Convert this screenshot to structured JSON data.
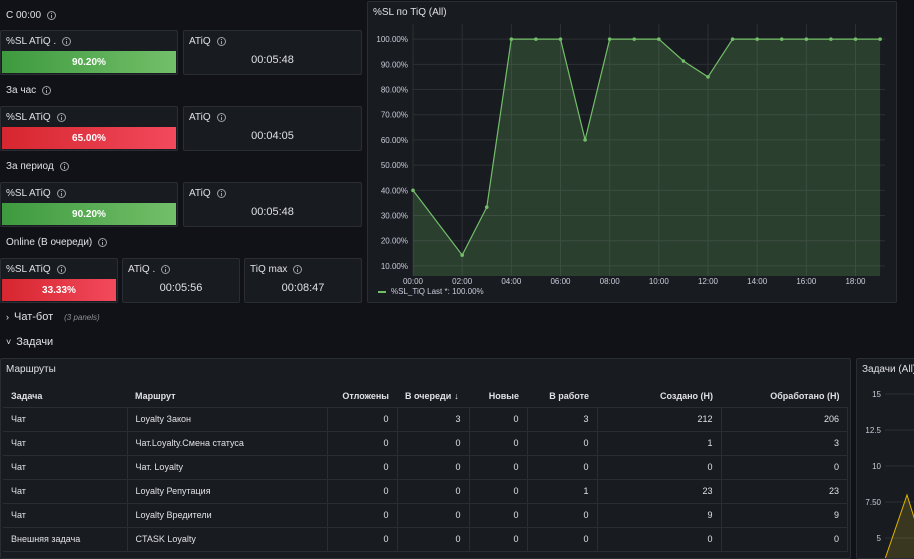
{
  "rows": {
    "c0000": "С 00:00",
    "hour": "За час",
    "period": "За период",
    "online": "Online (В очереди)"
  },
  "stats": {
    "c0000": {
      "sl_title": "%SL ATiQ .",
      "sl_value": "90.20%",
      "atiq_title": "ATiQ",
      "atiq_value": "00:05:48"
    },
    "hour": {
      "sl_title": "%SL ATiQ",
      "sl_value": "65.00%",
      "atiq_title": "ATiQ",
      "atiq_value": "00:04:05"
    },
    "period": {
      "sl_title": "%SL ATiQ",
      "sl_value": "90.20%",
      "atiq_title": "ATiQ",
      "atiq_value": "00:05:48"
    },
    "online": {
      "sl_title": "%SL ATiQ",
      "sl_value": "33.33%",
      "atiq_title": "ATiQ .",
      "atiq_value": "00:05:56",
      "tiq_title": "TiQ max",
      "tiq_value": "00:08:47"
    }
  },
  "colors": {
    "green": "#73bf69",
    "red": "#f2495c",
    "bg": "#111217",
    "panel": "#181b1f"
  },
  "chart": {
    "title": "%SL по TiQ (All)",
    "legend": "%SL_TiQ  Last *: 100.00%"
  },
  "chart_data": {
    "type": "area",
    "x": [
      "00:00",
      "02:00",
      "03:00",
      "04:00",
      "05:00",
      "06:00",
      "07:00",
      "08:00",
      "09:00",
      "10:00",
      "11:00",
      "12:00",
      "13:00",
      "14:00",
      "15:00",
      "16:00",
      "17:00",
      "18:00",
      "19:00"
    ],
    "x_hours": [
      0,
      2,
      3,
      4,
      5,
      6,
      7,
      8,
      9,
      10,
      11,
      12,
      13,
      14,
      15,
      16,
      17,
      18,
      19
    ],
    "series": [
      {
        "name": "%SL_TiQ",
        "values": [
          40,
          14.29,
          33.33,
          100,
          100,
          100,
          60,
          100,
          100,
          100,
          91.3,
          85,
          100,
          100,
          100,
          100,
          100,
          100,
          100
        ]
      }
    ],
    "x_ticks": [
      "00:00",
      "02:00",
      "04:00",
      "06:00",
      "08:00",
      "10:00",
      "12:00",
      "14:00",
      "16:00",
      "18:00"
    ],
    "y_ticks": [
      "10.00%",
      "20.00%",
      "30.00%",
      "40.00%",
      "50.00%",
      "60.00%",
      "70.00%",
      "80.00%",
      "90.00%",
      "100.00%"
    ],
    "ylim": [
      6,
      106
    ],
    "xlim": [
      0,
      19.2
    ],
    "color": "#73bf69"
  },
  "sections": {
    "chatbot": {
      "label": "Чат-бот",
      "count": "(3 panels)"
    },
    "tasks": {
      "label": "Задачи"
    }
  },
  "routes": {
    "title": "Маршруты",
    "columns": [
      "Задача",
      "Маршрут",
      "Отложены",
      "В очереди",
      "Новые",
      "В работе",
      "Создано (Н)",
      "Обработано (Н)"
    ],
    "rows": [
      [
        "Чат",
        "Loyalty Закон",
        "0",
        "3",
        "0",
        "3",
        "212",
        "206"
      ],
      [
        "Чат",
        "Чат.Loyalty.Смена статуса",
        "0",
        "0",
        "0",
        "0",
        "1",
        "3"
      ],
      [
        "Чат",
        "Чат. Loyalty",
        "0",
        "0",
        "0",
        "0",
        "0",
        "0"
      ],
      [
        "Чат",
        "Loyalty Репутация",
        "0",
        "0",
        "0",
        "1",
        "23",
        "23"
      ],
      [
        "Чат",
        "Loyalty Вредители",
        "0",
        "0",
        "0",
        "0",
        "9",
        "9"
      ],
      [
        "Внешняя задача",
        "CTASK Loyalty",
        "0",
        "0",
        "0",
        "0",
        "0",
        "0"
      ]
    ]
  },
  "tasks_chart": {
    "title": "Задачи (All)",
    "y_ticks": [
      "15",
      "12.5",
      "10",
      "7.50",
      "5"
    ]
  }
}
